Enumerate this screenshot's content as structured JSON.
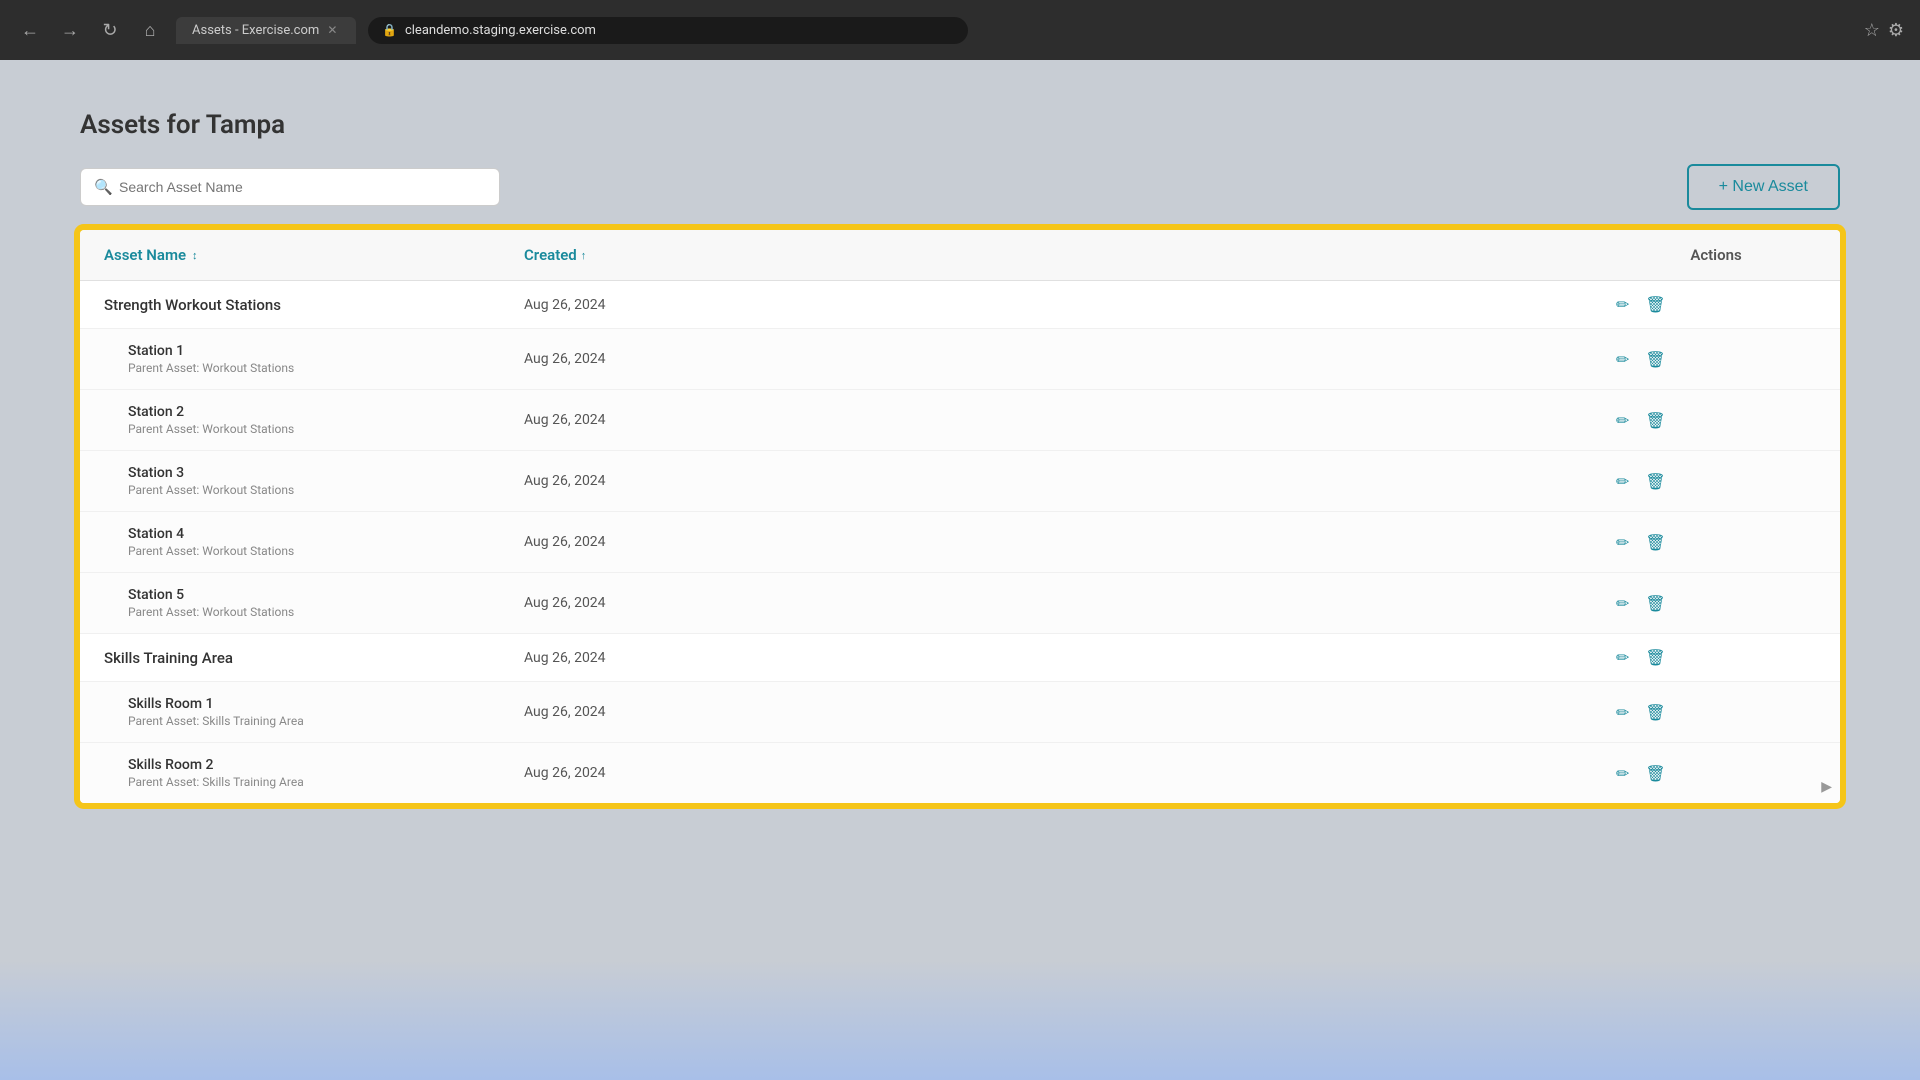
{
  "browser": {
    "url": "cleandemo.staging.exercise.com",
    "tab_label": "Assets - Exercise.com"
  },
  "page": {
    "title": "Assets for Tampa",
    "search_placeholder": "Search Asset Name",
    "new_asset_button": "+ New Asset"
  },
  "table": {
    "col_asset_name": "Asset Name",
    "col_created": "Created",
    "col_actions": "Actions",
    "rows": [
      {
        "id": "strength-workout-stations",
        "type": "parent",
        "name": "Strength Workout Stations",
        "parent_label": "",
        "created": "Aug 26, 2024"
      },
      {
        "id": "station-1",
        "type": "child",
        "name": "Station 1",
        "parent_label": "Parent Asset: Workout Stations",
        "created": "Aug 26, 2024"
      },
      {
        "id": "station-2",
        "type": "child",
        "name": "Station 2",
        "parent_label": "Parent Asset: Workout Stations",
        "created": "Aug 26, 2024"
      },
      {
        "id": "station-3",
        "type": "child",
        "name": "Station 3",
        "parent_label": "Parent Asset: Workout Stations",
        "created": "Aug 26, 2024"
      },
      {
        "id": "station-4",
        "type": "child",
        "name": "Station 4",
        "parent_label": "Parent Asset: Workout Stations",
        "created": "Aug 26, 2024"
      },
      {
        "id": "station-5",
        "type": "child",
        "name": "Station 5",
        "parent_label": "Parent Asset: Workout Stations",
        "created": "Aug 26, 2024"
      },
      {
        "id": "skills-training-area",
        "type": "parent",
        "name": "Skills Training Area",
        "parent_label": "",
        "created": "Aug 26, 2024"
      },
      {
        "id": "skills-room-1",
        "type": "child",
        "name": "Skills Room 1",
        "parent_label": "Parent Asset: Skills Training Area",
        "created": "Aug 26, 2024"
      },
      {
        "id": "skills-room-2",
        "type": "child",
        "name": "Skills Room 2",
        "parent_label": "Parent Asset: Skills Training Area",
        "created": "Aug 26, 2024"
      }
    ]
  },
  "colors": {
    "teal": "#1a8a9c",
    "highlight": "#f5c518"
  }
}
